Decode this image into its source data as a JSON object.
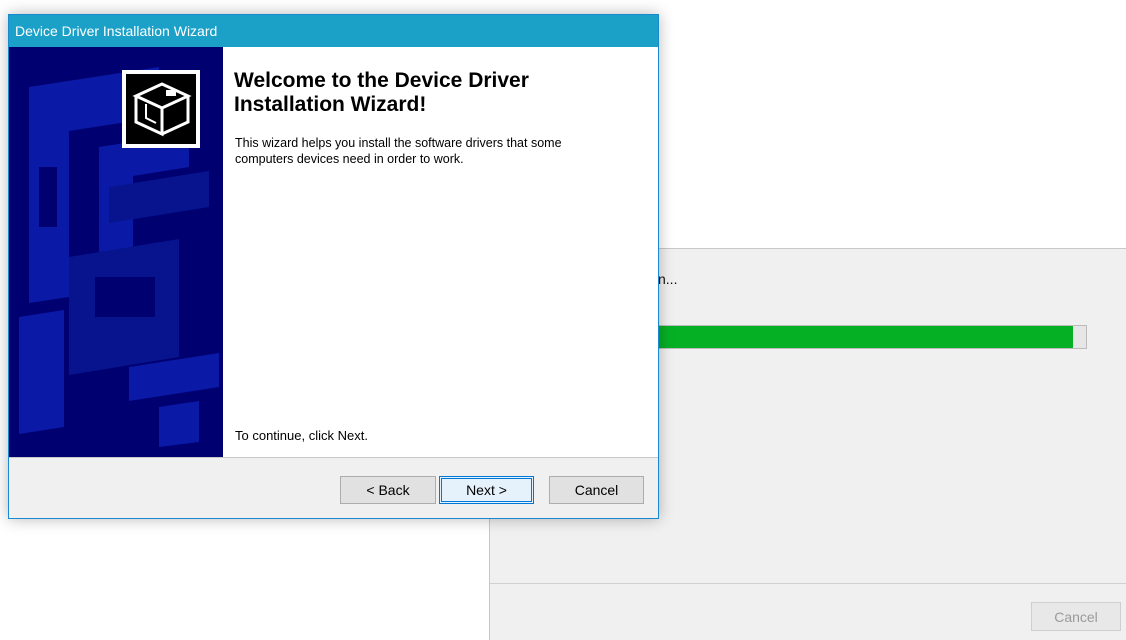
{
  "wizard": {
    "title": "Device Driver Installation Wizard",
    "heading": "Welcome to the Device Driver Installation Wizard!",
    "intro": "This wizard helps you install the software drivers that some computers devices need in order to work.",
    "continue_text": "To continue, click Next.",
    "buttons": {
      "back": "< Back",
      "next": "Next >",
      "cancel": "Cancel"
    },
    "icon": "driver-box-icon"
  },
  "background_window": {
    "status_text": "n...",
    "progress_fraction": 0.97,
    "cancel_label": "Cancel"
  },
  "colors": {
    "titlebar": "#1ba1c7",
    "side_panel": "#000070",
    "progress": "#06b025",
    "default_button_border": "#0078d7"
  }
}
